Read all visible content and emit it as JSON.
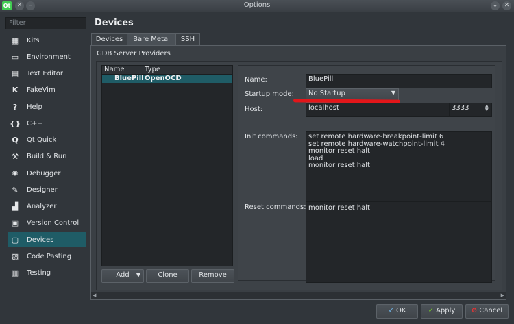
{
  "window": {
    "title": "Options"
  },
  "filter": {
    "placeholder": "Filter"
  },
  "sidebar": {
    "items": [
      {
        "label": "Kits",
        "icon": "kits-icon",
        "glyph": "▦"
      },
      {
        "label": "Environment",
        "icon": "monitor-icon",
        "glyph": "▭"
      },
      {
        "label": "Text Editor",
        "icon": "text-editor-icon",
        "glyph": "▤"
      },
      {
        "label": "FakeVim",
        "icon": "fakevim-icon",
        "glyph": "K"
      },
      {
        "label": "Help",
        "icon": "help-icon",
        "glyph": "?"
      },
      {
        "label": "C++",
        "icon": "braces-icon",
        "glyph": "{}"
      },
      {
        "label": "Qt Quick",
        "icon": "qt-quick-icon",
        "glyph": "Q"
      },
      {
        "label": "Build & Run",
        "icon": "hammer-icon",
        "glyph": "⚒"
      },
      {
        "label": "Debugger",
        "icon": "bug-icon",
        "glyph": "✺"
      },
      {
        "label": "Designer",
        "icon": "pencil-icon",
        "glyph": "✎"
      },
      {
        "label": "Analyzer",
        "icon": "analyzer-icon",
        "glyph": "▟"
      },
      {
        "label": "Version Control",
        "icon": "version-control-icon",
        "glyph": "▣"
      },
      {
        "label": "Devices",
        "icon": "devices-icon",
        "glyph": "▢"
      },
      {
        "label": "Code Pasting",
        "icon": "paste-icon",
        "glyph": "▧"
      },
      {
        "label": "Testing",
        "icon": "testing-icon",
        "glyph": "▥"
      }
    ],
    "active_index": 12
  },
  "page": {
    "title": "Devices"
  },
  "tabs": {
    "devices": "Devices",
    "bare_metal": "Bare Metal",
    "ssh": "SSH"
  },
  "group": {
    "title": "GDB Server Providers"
  },
  "list": {
    "columns": {
      "name": "Name",
      "type": "Type"
    },
    "rows": [
      {
        "name": "BluePill",
        "type": "OpenOCD"
      }
    ]
  },
  "list_buttons": {
    "add": "Add",
    "clone": "Clone",
    "remove": "Remove"
  },
  "form": {
    "name_label": "Name:",
    "name_value": "BluePill",
    "startup_label": "Startup mode:",
    "startup_value": "No Startup",
    "host_label": "Host:",
    "host_value": "localhost",
    "port_value": "3333",
    "init_label": "Init commands:",
    "init_lines": [
      "set remote hardware-breakpoint-limit 6",
      "set remote hardware-watchpoint-limit 4",
      "monitor reset halt",
      "load",
      "monitor reset halt"
    ],
    "reset_label": "Reset commands:",
    "reset_value": "monitor reset halt"
  },
  "dialog_buttons": {
    "ok": "OK",
    "apply": "Apply",
    "cancel": "Cancel"
  },
  "colors": {
    "highlight": "#1f5c66",
    "annotation": "#e3161a",
    "background": "#31363b"
  }
}
